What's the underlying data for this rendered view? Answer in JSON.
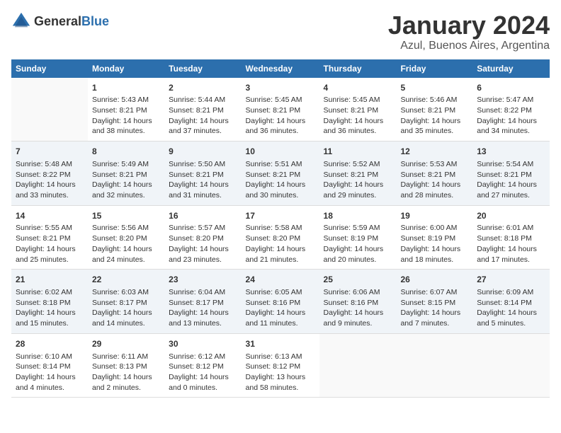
{
  "logo": {
    "general": "General",
    "blue": "Blue"
  },
  "title": "January 2024",
  "subtitle": "Azul, Buenos Aires, Argentina",
  "days_header": [
    "Sunday",
    "Monday",
    "Tuesday",
    "Wednesday",
    "Thursday",
    "Friday",
    "Saturday"
  ],
  "weeks": [
    [
      {
        "day": "",
        "info": ""
      },
      {
        "day": "1",
        "info": "Sunrise: 5:43 AM\nSunset: 8:21 PM\nDaylight: 14 hours\nand 38 minutes."
      },
      {
        "day": "2",
        "info": "Sunrise: 5:44 AM\nSunset: 8:21 PM\nDaylight: 14 hours\nand 37 minutes."
      },
      {
        "day": "3",
        "info": "Sunrise: 5:45 AM\nSunset: 8:21 PM\nDaylight: 14 hours\nand 36 minutes."
      },
      {
        "day": "4",
        "info": "Sunrise: 5:45 AM\nSunset: 8:21 PM\nDaylight: 14 hours\nand 36 minutes."
      },
      {
        "day": "5",
        "info": "Sunrise: 5:46 AM\nSunset: 8:21 PM\nDaylight: 14 hours\nand 35 minutes."
      },
      {
        "day": "6",
        "info": "Sunrise: 5:47 AM\nSunset: 8:22 PM\nDaylight: 14 hours\nand 34 minutes."
      }
    ],
    [
      {
        "day": "7",
        "info": "Sunrise: 5:48 AM\nSunset: 8:22 PM\nDaylight: 14 hours\nand 33 minutes."
      },
      {
        "day": "8",
        "info": "Sunrise: 5:49 AM\nSunset: 8:21 PM\nDaylight: 14 hours\nand 32 minutes."
      },
      {
        "day": "9",
        "info": "Sunrise: 5:50 AM\nSunset: 8:21 PM\nDaylight: 14 hours\nand 31 minutes."
      },
      {
        "day": "10",
        "info": "Sunrise: 5:51 AM\nSunset: 8:21 PM\nDaylight: 14 hours\nand 30 minutes."
      },
      {
        "day": "11",
        "info": "Sunrise: 5:52 AM\nSunset: 8:21 PM\nDaylight: 14 hours\nand 29 minutes."
      },
      {
        "day": "12",
        "info": "Sunrise: 5:53 AM\nSunset: 8:21 PM\nDaylight: 14 hours\nand 28 minutes."
      },
      {
        "day": "13",
        "info": "Sunrise: 5:54 AM\nSunset: 8:21 PM\nDaylight: 14 hours\nand 27 minutes."
      }
    ],
    [
      {
        "day": "14",
        "info": "Sunrise: 5:55 AM\nSunset: 8:21 PM\nDaylight: 14 hours\nand 25 minutes."
      },
      {
        "day": "15",
        "info": "Sunrise: 5:56 AM\nSunset: 8:20 PM\nDaylight: 14 hours\nand 24 minutes."
      },
      {
        "day": "16",
        "info": "Sunrise: 5:57 AM\nSunset: 8:20 PM\nDaylight: 14 hours\nand 23 minutes."
      },
      {
        "day": "17",
        "info": "Sunrise: 5:58 AM\nSunset: 8:20 PM\nDaylight: 14 hours\nand 21 minutes."
      },
      {
        "day": "18",
        "info": "Sunrise: 5:59 AM\nSunset: 8:19 PM\nDaylight: 14 hours\nand 20 minutes."
      },
      {
        "day": "19",
        "info": "Sunrise: 6:00 AM\nSunset: 8:19 PM\nDaylight: 14 hours\nand 18 minutes."
      },
      {
        "day": "20",
        "info": "Sunrise: 6:01 AM\nSunset: 8:18 PM\nDaylight: 14 hours\nand 17 minutes."
      }
    ],
    [
      {
        "day": "21",
        "info": "Sunrise: 6:02 AM\nSunset: 8:18 PM\nDaylight: 14 hours\nand 15 minutes."
      },
      {
        "day": "22",
        "info": "Sunrise: 6:03 AM\nSunset: 8:17 PM\nDaylight: 14 hours\nand 14 minutes."
      },
      {
        "day": "23",
        "info": "Sunrise: 6:04 AM\nSunset: 8:17 PM\nDaylight: 14 hours\nand 13 minutes."
      },
      {
        "day": "24",
        "info": "Sunrise: 6:05 AM\nSunset: 8:16 PM\nDaylight: 14 hours\nand 11 minutes."
      },
      {
        "day": "25",
        "info": "Sunrise: 6:06 AM\nSunset: 8:16 PM\nDaylight: 14 hours\nand 9 minutes."
      },
      {
        "day": "26",
        "info": "Sunrise: 6:07 AM\nSunset: 8:15 PM\nDaylight: 14 hours\nand 7 minutes."
      },
      {
        "day": "27",
        "info": "Sunrise: 6:09 AM\nSunset: 8:14 PM\nDaylight: 14 hours\nand 5 minutes."
      }
    ],
    [
      {
        "day": "28",
        "info": "Sunrise: 6:10 AM\nSunset: 8:14 PM\nDaylight: 14 hours\nand 4 minutes."
      },
      {
        "day": "29",
        "info": "Sunrise: 6:11 AM\nSunset: 8:13 PM\nDaylight: 14 hours\nand 2 minutes."
      },
      {
        "day": "30",
        "info": "Sunrise: 6:12 AM\nSunset: 8:12 PM\nDaylight: 14 hours\nand 0 minutes."
      },
      {
        "day": "31",
        "info": "Sunrise: 6:13 AM\nSunset: 8:12 PM\nDaylight: 13 hours\nand 58 minutes."
      },
      {
        "day": "",
        "info": ""
      },
      {
        "day": "",
        "info": ""
      },
      {
        "day": "",
        "info": ""
      }
    ]
  ]
}
